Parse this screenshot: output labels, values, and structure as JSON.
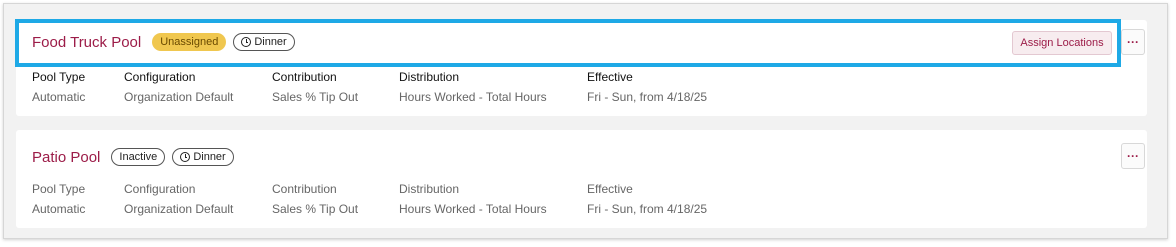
{
  "pools": [
    {
      "name": "Food Truck Pool",
      "status_badge": "Unassigned",
      "shift_badge": "Dinner",
      "assign_label": "Assign Locations",
      "more_label": "···",
      "fields": [
        {
          "label": "Pool Type",
          "value": "Automatic"
        },
        {
          "label": "Configuration",
          "value": "Organization Default"
        },
        {
          "label": "Contribution",
          "value": "Sales % Tip Out"
        },
        {
          "label": "Distribution",
          "value": "Hours Worked - Total Hours"
        },
        {
          "label": "Effective",
          "value": "Fri - Sun, from 4/18/25"
        }
      ]
    },
    {
      "name": "Patio Pool",
      "status_badge": "Inactive",
      "shift_badge": "Dinner",
      "more_label": "···",
      "fields": [
        {
          "label": "Pool Type",
          "value": "Automatic"
        },
        {
          "label": "Configuration",
          "value": "Organization Default"
        },
        {
          "label": "Contribution",
          "value": "Sales % Tip Out"
        },
        {
          "label": "Distribution",
          "value": "Hours Worked - Total Hours"
        },
        {
          "label": "Effective",
          "value": "Fri - Sun, from 4/18/25"
        }
      ]
    }
  ],
  "colors": {
    "title": "#9c1c48",
    "highlight": "#1ea9e6",
    "unassigned_badge": "#f0c74f"
  },
  "icons": [
    "clock-icon",
    "more-options-icon"
  ]
}
